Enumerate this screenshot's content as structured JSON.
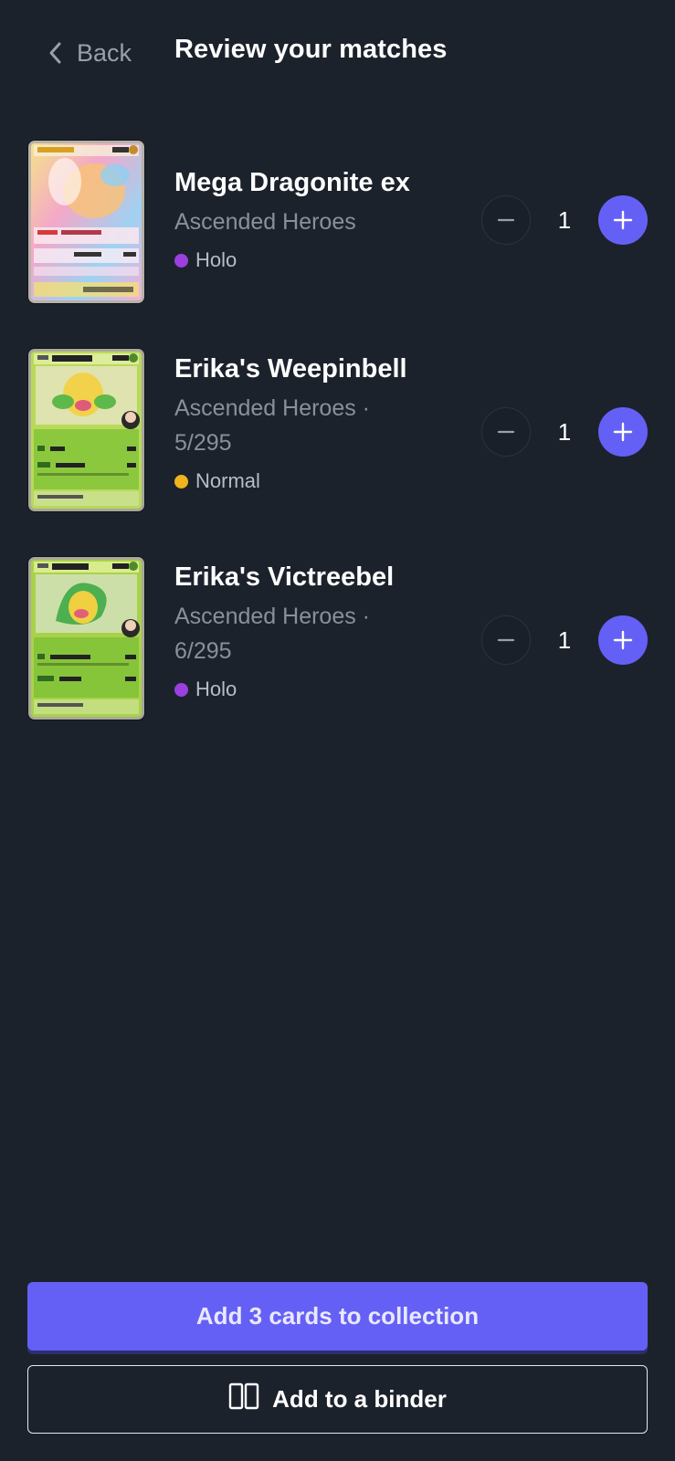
{
  "header": {
    "back_label": "Back",
    "title": "Review your matches"
  },
  "cards": [
    {
      "name": "Mega Dragonite ex",
      "set": "Ascended Heroes",
      "finish": "Holo",
      "finish_color": "#9b3fe0",
      "quantity": "1",
      "thumbnail_icon": "mega-dragonite-card-art"
    },
    {
      "name": "Erika's Weepinbell",
      "set": "Ascended Heroes · 5/295",
      "finish": "Normal",
      "finish_color": "#f0b31c",
      "quantity": "1",
      "thumbnail_icon": "weepinbell-card-art"
    },
    {
      "name": "Erika's Victreebel",
      "set": "Ascended Heroes · 6/295",
      "finish": "Holo",
      "finish_color": "#9b3fe0",
      "quantity": "1",
      "thumbnail_icon": "victreebel-card-art"
    }
  ],
  "actions": {
    "add_to_collection": "Add 3 cards to collection",
    "add_to_binder": "Add to a binder"
  },
  "colors": {
    "background": "#1c222c",
    "accent": "#6560f5",
    "muted_text": "#8a909b"
  }
}
